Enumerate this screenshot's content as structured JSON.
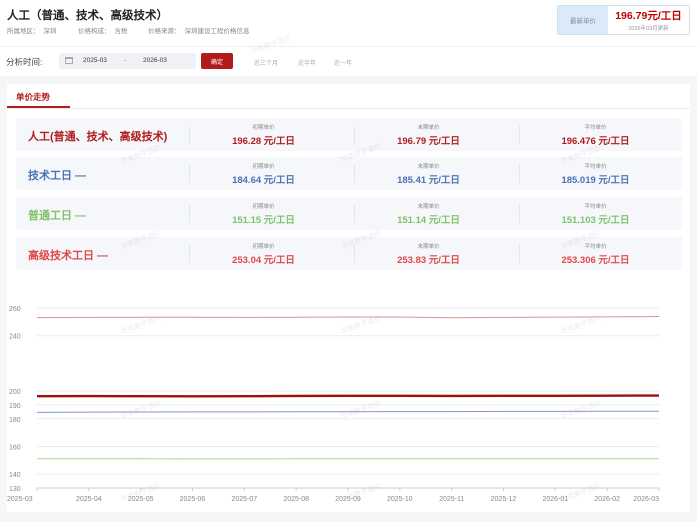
{
  "header": {
    "title": "人工（普通、技术、高级技术）",
    "meta": [
      {
        "key": "所属地区：",
        "value": "深圳"
      },
      {
        "key": "价格构成：",
        "value": "含税"
      },
      {
        "key": "价格来源：",
        "value": "深圳建设工程价格信息"
      }
    ]
  },
  "latest": {
    "label": "最新单价",
    "price": "196.79元/工日",
    "date": "2026年03月更新"
  },
  "toolbar": {
    "label": "分析时间:",
    "date_from": "2025-03",
    "date_sep": "-",
    "date_to": "2026-03",
    "confirm_label": "确定",
    "quick_ranges": [
      "近三个月",
      "近半年",
      "近一年"
    ]
  },
  "tab": {
    "label": "单价走势"
  },
  "col_labels": [
    "初期单价",
    "末期单价",
    "平均单价"
  ],
  "rows": [
    {
      "name": "人工(普通、技术、高级技术)",
      "color": "#b01c1c",
      "values": [
        "196.28 元/工日",
        "196.79 元/工日",
        "196.476 元/工日"
      ]
    },
    {
      "name": "技术工日 —",
      "color": "#4a72b5",
      "values": [
        "184.64 元/工日",
        "185.41 元/工日",
        "185.019 元/工日"
      ]
    },
    {
      "name": "普通工日 —",
      "color": "#7ec36a",
      "values": [
        "151.15 元/工日",
        "151.14 元/工日",
        "151.103 元/工日"
      ]
    },
    {
      "name": "高级技术工日 —",
      "color": "#e04848",
      "values": [
        "253.04 元/工日",
        "253.83 元/工日",
        "253.306 元/工日"
      ]
    }
  ],
  "watermark_text": "华筑数字造价",
  "chart_data": {
    "type": "line",
    "x": [
      "2025-03",
      "2025-04",
      "2025-05",
      "2025-06",
      "2025-07",
      "2025-08",
      "2025-09",
      "2025-10",
      "2025-11",
      "2025-12",
      "2026-01",
      "2026-02",
      "2026-03"
    ],
    "yticks": [
      130,
      140,
      160,
      180,
      190,
      200,
      240,
      260
    ],
    "ylim": [
      130,
      260
    ],
    "grid": true,
    "series": [
      {
        "name": "人工(普通、技术、高级技术)",
        "color": "#a01010",
        "values": [
          196.28,
          196.4,
          196.3,
          196.2,
          196.3,
          196.5,
          196.6,
          196.6,
          196.5,
          196.6,
          196.6,
          196.7,
          196.79
        ]
      },
      {
        "name": "技术工日",
        "color": "#7f99c4",
        "values": [
          184.64,
          184.8,
          184.9,
          185.0,
          185.0,
          185.1,
          185.1,
          185.2,
          185.2,
          185.3,
          185.3,
          185.4,
          185.41
        ]
      },
      {
        "name": "普通工日",
        "color": "#a7d68f",
        "values": [
          151.15,
          151.1,
          151.1,
          151.0,
          151.0,
          151.1,
          151.1,
          151.1,
          151.1,
          151.1,
          151.1,
          151.1,
          151.14
        ]
      },
      {
        "name": "高级技术工日",
        "color": "#e59090",
        "values": [
          253.04,
          253.2,
          253.3,
          253.3,
          253.2,
          253.3,
          253.5,
          253.5,
          253.0,
          253.2,
          253.4,
          253.6,
          253.83
        ]
      }
    ]
  }
}
